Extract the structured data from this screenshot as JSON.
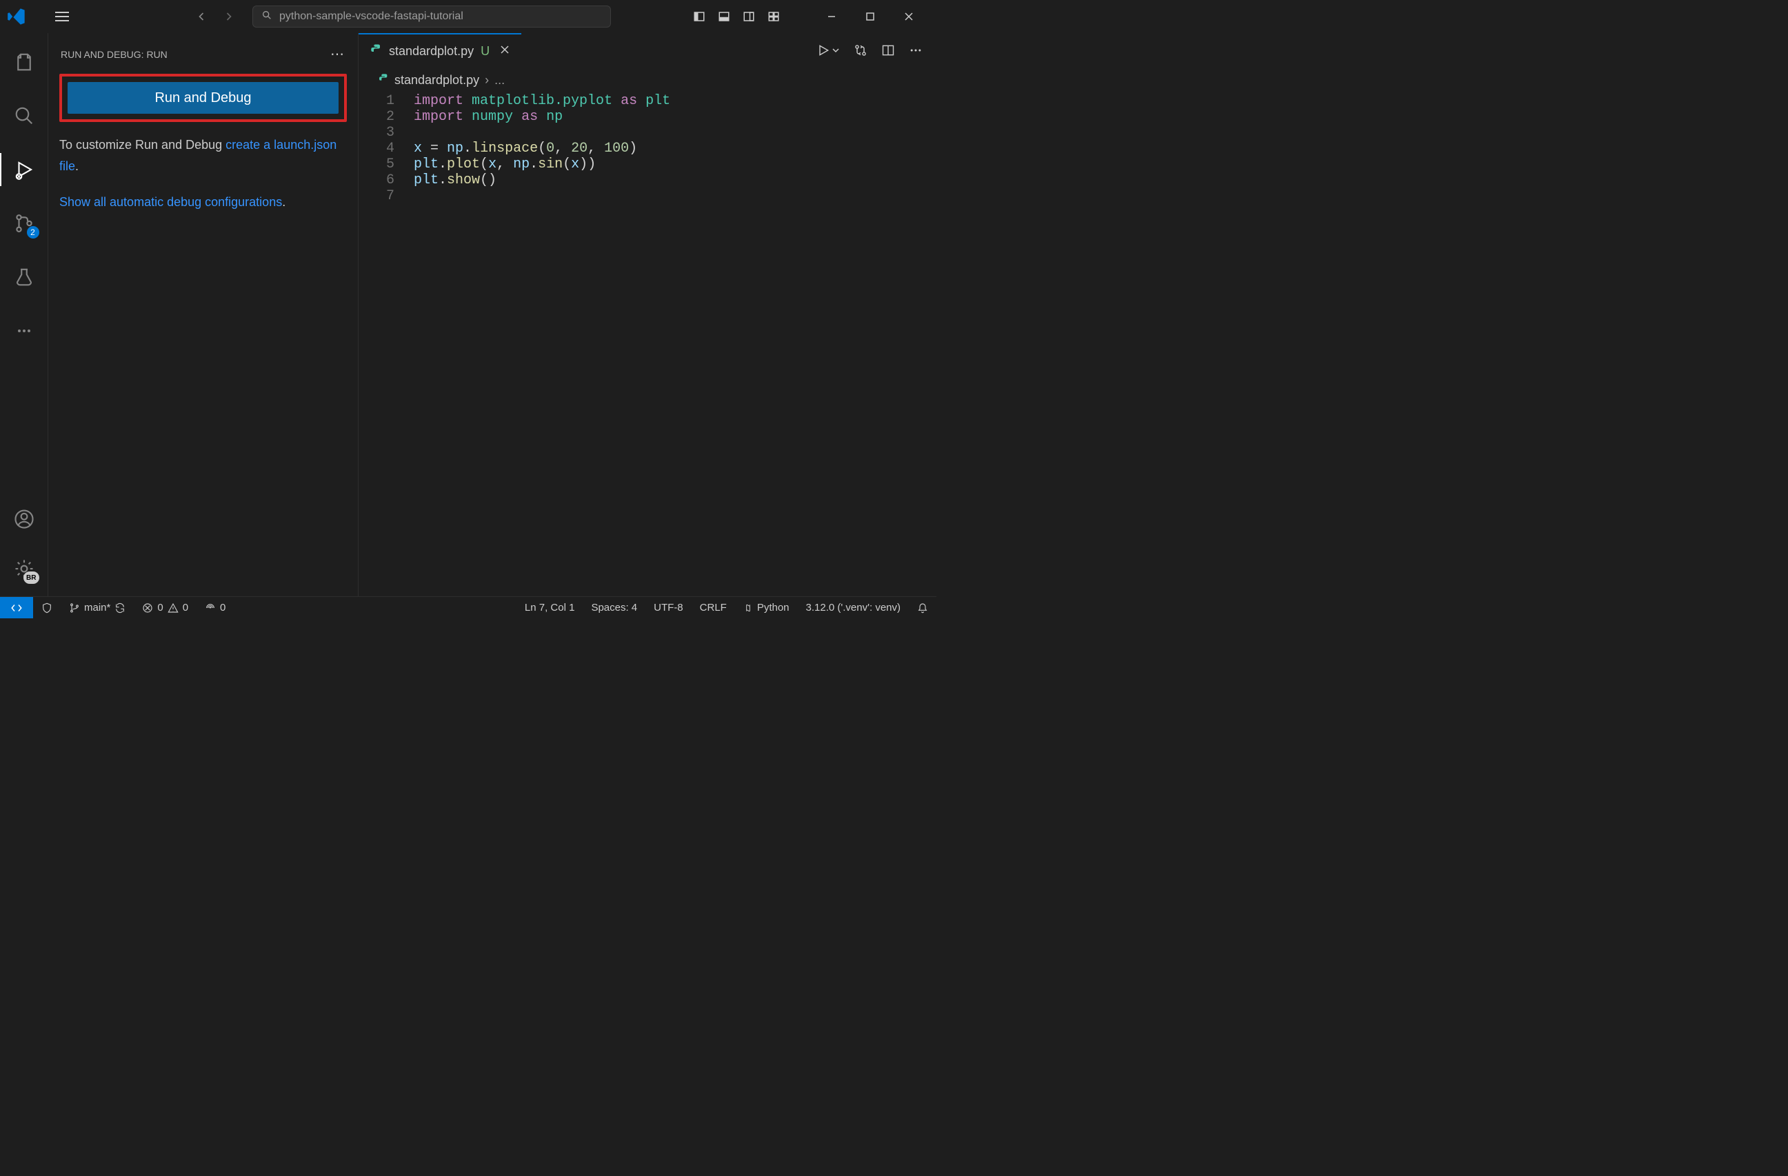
{
  "titlebar": {
    "search_placeholder": "python-sample-vscode-fastapi-tutorial"
  },
  "sidebar": {
    "header": "RUN AND DEBUG: RUN",
    "run_button": "Run and Debug",
    "customize_text": "To customize Run and Debug ",
    "create_link": "create a launch.json file",
    "show_link": "Show all automatic debug configurations",
    "period": "."
  },
  "activitybar": {
    "scm_badge": "2",
    "settings_badge": "BR"
  },
  "editor": {
    "tab_filename": "standardplot.py",
    "tab_modified": "U",
    "breadcrumb_file": "standardplot.py",
    "breadcrumb_more": "...",
    "lines": [
      "1",
      "2",
      "3",
      "4",
      "5",
      "6",
      "7"
    ]
  },
  "code": {
    "l1_import": "import",
    "l1_mod": "matplotlib.pyplot",
    "l1_as": "as",
    "l1_alias": "plt",
    "l2_import": "import",
    "l2_mod": "numpy",
    "l2_as": "as",
    "l2_alias": "np",
    "l4_var": "x",
    "l4_eq": " = ",
    "l4_np": "np",
    "l4_dot": ".",
    "l4_func": "linspace",
    "l4_open": "(",
    "l4_a1": "0",
    "l4_c1": ", ",
    "l4_a2": "20",
    "l4_c2": ", ",
    "l4_a3": "100",
    "l4_close": ")",
    "l5_plt": "plt",
    "l5_dot": ".",
    "l5_plot": "plot",
    "l5_open": "(",
    "l5_x": "x",
    "l5_c": ", ",
    "l5_np": "np",
    "l5_dot2": ".",
    "l5_sin": "sin",
    "l5_open2": "(",
    "l5_x2": "x",
    "l5_close2": ")",
    "l5_close": ")",
    "l6_plt": "plt",
    "l6_dot": ".",
    "l6_show": "show",
    "l6_parens": "()"
  },
  "statusbar": {
    "branch": "main*",
    "errors": "0",
    "warnings": "0",
    "ports": "0",
    "cursor": "Ln 7, Col 1",
    "spaces": "Spaces: 4",
    "encoding": "UTF-8",
    "eol": "CRLF",
    "lang": "Python",
    "interpreter": "3.12.0 ('.venv': venv)"
  }
}
